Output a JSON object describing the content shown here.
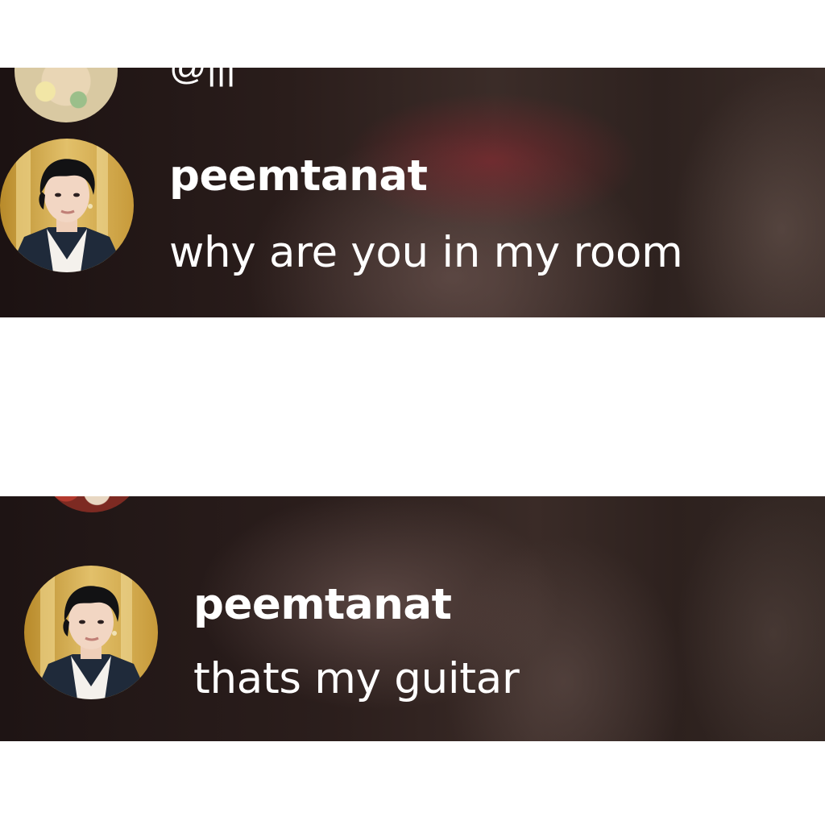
{
  "comments": [
    {
      "username": "peemtanat",
      "message": "why are you in my room",
      "previous_comment_fragment": "@|||"
    },
    {
      "username": "peemtanat",
      "message": "thats my guitar"
    }
  ],
  "colors": {
    "page_background": "#ffffff",
    "text": "#ffffff",
    "panel_dark": "#2a1d1b"
  },
  "icons": {
    "avatar": "profile-photo"
  }
}
